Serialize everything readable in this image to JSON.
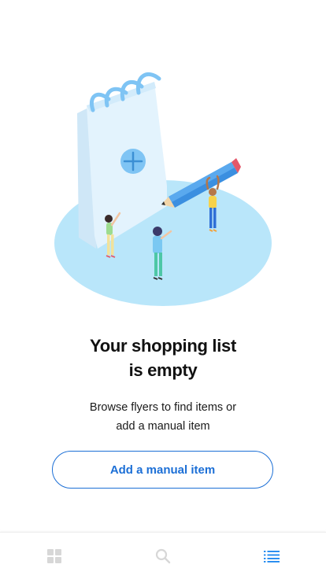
{
  "empty_state": {
    "illustration_icon": "notepad-pencil-people-illustration",
    "title_line1": "Your shopping list",
    "title_line2": "is empty",
    "subtitle_line1": "Browse flyers to find items or",
    "subtitle_line2": "add a manual item",
    "cta_label": "Add a manual item"
  },
  "tab_bar": {
    "tabs": [
      {
        "icon": "grid-icon",
        "active": false
      },
      {
        "icon": "search-icon",
        "active": false
      },
      {
        "icon": "list-icon",
        "active": true
      }
    ]
  },
  "colors": {
    "accent": "#1c6fd6",
    "tab_inactive": "#d7d7d7",
    "tab_active": "#2b8ff0",
    "illustration_blue": "#b9e6fa"
  }
}
